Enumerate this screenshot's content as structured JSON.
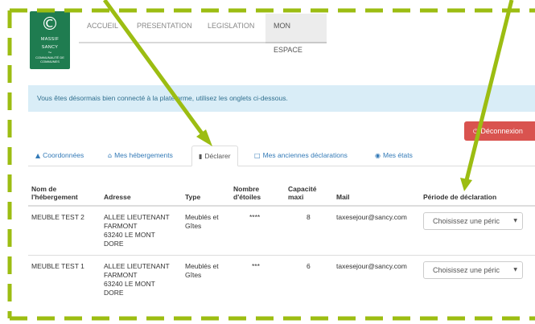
{
  "logo": {
    "line1": "MASSIF",
    "line2": "SANCY",
    "line3": "COMMUNAUTÉ DE COMMUNES"
  },
  "nav": {
    "items": [
      {
        "label": "ACCUEIL"
      },
      {
        "label": "PRESENTATION"
      },
      {
        "label": "LEGISLATION"
      },
      {
        "label": "MON ESPACE"
      }
    ],
    "active": "MON ESPACE"
  },
  "alert": {
    "text": "Vous êtes désormais bien connecté à la plateforme, utilisez les onglets ci-dessous."
  },
  "logout": {
    "label": "Déconnexion",
    "icon": "power-icon"
  },
  "tabs": [
    {
      "label": "Coordonnées",
      "icon": "user-icon"
    },
    {
      "label": "Mes hébergements",
      "icon": "home-icon"
    },
    {
      "label": "Déclarer",
      "icon": "file-icon",
      "active": true
    },
    {
      "label": "Mes anciennes déclarations",
      "icon": "inbox-icon"
    },
    {
      "label": "Mes états",
      "icon": "eye-icon"
    }
  ],
  "table": {
    "headers": {
      "name_1": "Nom de",
      "name_2": "l'hébergement",
      "address": "Adresse",
      "type": "Type",
      "stars_1": "Nombre",
      "stars_2": "d'étoiles",
      "capacity_1": "Capacité",
      "capacity_2": "maxi",
      "mail": "Mail",
      "period": "Période de déclaration"
    },
    "rows": [
      {
        "name": "MEUBLE TEST 2",
        "address_1": "ALLEE LIEUTENANT",
        "address_2": "FARMONT",
        "address_3": "63240 LE MONT",
        "address_4": "DORE",
        "type_1": "Meublés et",
        "type_2": "Gîtes",
        "stars": "****",
        "capacity": "8",
        "mail": "taxesejour@sancy.com",
        "period_placeholder": "Choisissez une péric"
      },
      {
        "name": "MEUBLE TEST 1",
        "address_1": "ALLEE LIEUTENANT",
        "address_2": "FARMONT",
        "address_3": "63240 LE MONT",
        "address_4": "DORE",
        "type_1": "Meublés et",
        "type_2": "Gîtes",
        "stars": "***",
        "capacity": "6",
        "mail": "taxesejour@sancy.com",
        "period_placeholder": "Choisissez une péric"
      }
    ]
  },
  "colors": {
    "brand_green": "#1f7c50",
    "annotation_lime": "#9cbd12",
    "alert_bg": "#d9edf7",
    "logout_red": "#d9534f",
    "link_blue": "#337ab7"
  }
}
